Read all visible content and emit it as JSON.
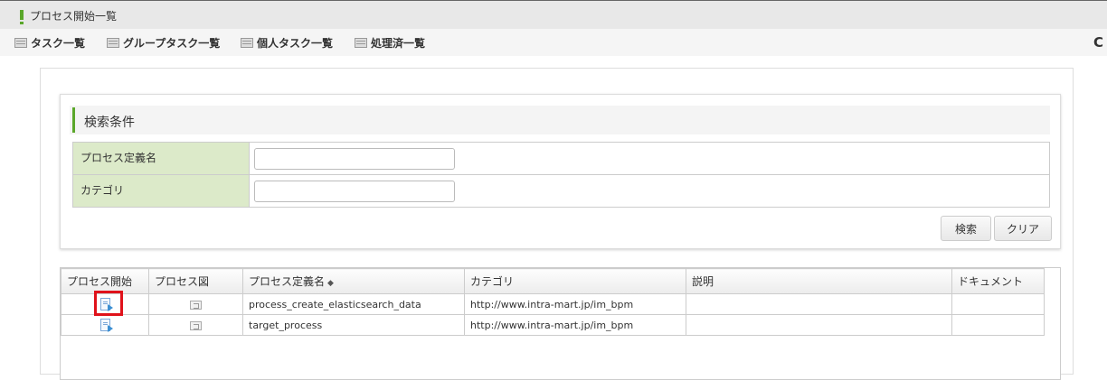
{
  "titlebar": {
    "title": "プロセス開始一覧"
  },
  "tabs": [
    {
      "label": "タスク一覧"
    },
    {
      "label": "グループタスク一覧"
    },
    {
      "label": "個人タスク一覧"
    },
    {
      "label": "処理済一覧"
    }
  ],
  "reload": {
    "glyph": "C"
  },
  "search": {
    "heading": "検索条件",
    "fields": [
      {
        "label": "プロセス定義名",
        "value": "",
        "placeholder": ""
      },
      {
        "label": "カテゴリ",
        "value": "",
        "placeholder": ""
      }
    ],
    "search_label": "検索",
    "clear_label": "クリア"
  },
  "grid": {
    "columns": [
      "プロセス開始",
      "プロセス図",
      "プロセス定義名",
      "カテゴリ",
      "説明",
      "ドキュメント"
    ],
    "sort_glyph": "◆",
    "rows": [
      {
        "name": "process_create_elasticsearch_data",
        "category": "http://www.intra-mart.jp/im_bpm",
        "description": "",
        "document": ""
      },
      {
        "name": "target_process",
        "category": "http://www.intra-mart.jp/im_bpm",
        "description": "",
        "document": ""
      }
    ]
  },
  "icons": {
    "title_mark": "exclamation-icon",
    "tab": "list-icon",
    "reload": "reload-icon",
    "start": "process-start-icon",
    "diagram": "process-diagram-icon"
  },
  "colors": {
    "accent": "#5aa72a",
    "label_bg": "#dceac9",
    "highlight": "#e0121a",
    "link_blue": "#3b8fd3"
  }
}
